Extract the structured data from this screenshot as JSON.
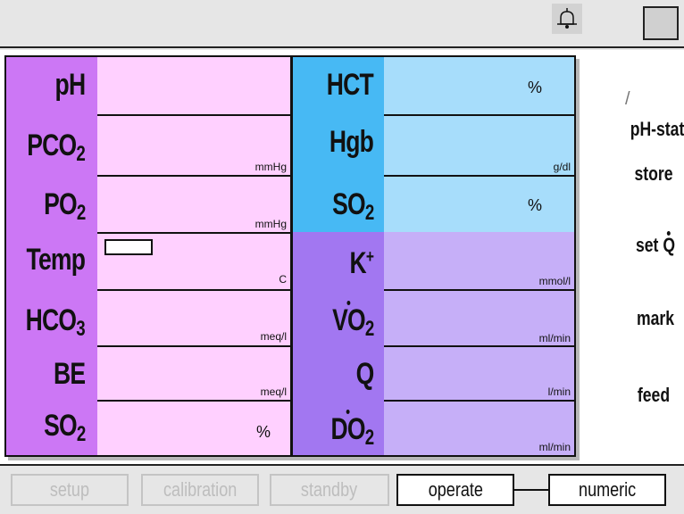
{
  "header": {
    "alarm_icon": "bell-icon",
    "corner_button": "square-button"
  },
  "left_params": [
    {
      "label": "pH",
      "sub": "",
      "unit": ""
    },
    {
      "label": "PCO",
      "sub": "2",
      "unit": "mmHg"
    },
    {
      "label": "PO",
      "sub": "2",
      "unit": "mmHg"
    },
    {
      "label": "Temp",
      "sub": "",
      "unit": "C"
    },
    {
      "label": "HCO",
      "sub": "3",
      "unit": "meq/l"
    },
    {
      "label": "BE",
      "sub": "",
      "unit": "meq/l"
    },
    {
      "label": "SO",
      "sub": "2",
      "unit": "%"
    }
  ],
  "right_params": [
    {
      "label": "HCT",
      "sub": "",
      "sup": "",
      "unit": "%"
    },
    {
      "label": "Hgb",
      "sub": "",
      "sup": "",
      "unit": "g/dl"
    },
    {
      "label": "SO",
      "sub": "2",
      "sup": "",
      "unit": "%"
    },
    {
      "label": "K",
      "sub": "",
      "sup": "+",
      "unit": "mmol/l"
    },
    {
      "label": "VO",
      "sub": "2",
      "sup": "",
      "unit": "ml/min",
      "dot": true
    },
    {
      "label": "Q",
      "sub": "",
      "sup": "",
      "unit": "l/min"
    },
    {
      "label": "DO",
      "sub": "2",
      "sup": "",
      "unit": "ml/min",
      "dot": true
    }
  ],
  "side_menu": {
    "slash": "/",
    "ph_stat": "pH-stat",
    "store": "store",
    "set_q_prefix": "set ",
    "set_q_letter": "Q",
    "mark": "mark",
    "feed": "feed"
  },
  "bottom_tabs": {
    "setup": "setup",
    "calibration": "calibration",
    "standby": "standby",
    "operate": "operate",
    "numeric": "numeric"
  },
  "colors": {
    "left_label": "#cc77f5",
    "left_value": "#ffd0ff",
    "right_top_label": "#47b9f4",
    "right_top_value": "#a7ddfb",
    "right_bottom_label": "#a277f1",
    "right_bottom_value": "#c6aff8"
  }
}
